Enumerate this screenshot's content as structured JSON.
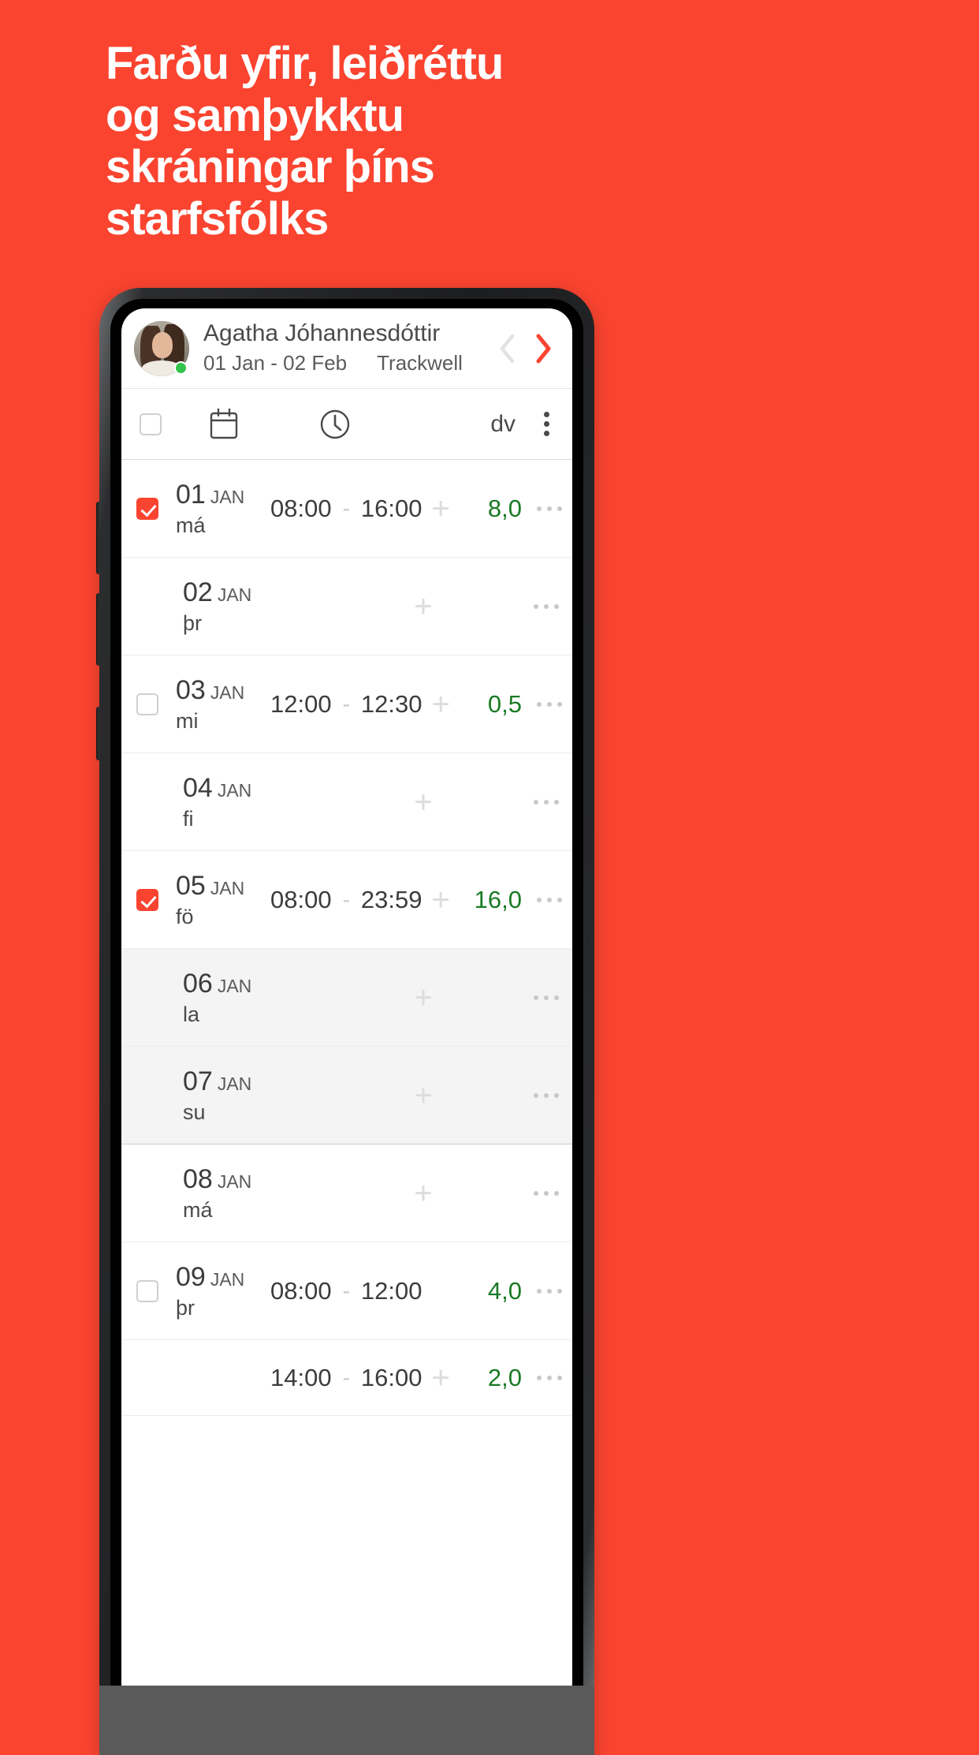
{
  "page": {
    "background_color": "#FA4430",
    "headline_lines": [
      "Farðu yfir, leiðréttu",
      "og samþykktu",
      "skráningar þíns",
      "starfsfólks"
    ]
  },
  "app": {
    "header": {
      "user_name": "Agatha Jóhannesdóttir",
      "date_range": "01 Jan - 02 Feb",
      "company": "Trackwell",
      "prev_label": "‹",
      "next_label": "›",
      "prev_color": "#e0e0e0",
      "next_color": "#FA4430",
      "avatar_name": "avatar",
      "status": "online"
    },
    "toolbar": {
      "select_all_checked": false,
      "calendar_icon": "calendar-icon",
      "clock_icon": "clock-icon",
      "value_column_label": "dv",
      "overflow_icon": "kebab-vertical-icon"
    },
    "accent_color": "#FA4430",
    "value_color": "#1a7a25",
    "rows": [
      {
        "checkbox": "checked",
        "day": "01",
        "month": "JAN",
        "weekday": "má",
        "start": "08:00",
        "end": "16:00",
        "has_plus": true,
        "value": "8,0",
        "weekend": false
      },
      {
        "checkbox": "none",
        "day": "02",
        "month": "JAN",
        "weekday": "þr",
        "start": "",
        "end": "",
        "has_plus": true,
        "value": "",
        "weekend": false
      },
      {
        "checkbox": "unchecked",
        "day": "03",
        "month": "JAN",
        "weekday": "mi",
        "start": "12:00",
        "end": "12:30",
        "has_plus": true,
        "value": "0,5",
        "weekend": false
      },
      {
        "checkbox": "none",
        "day": "04",
        "month": "JAN",
        "weekday": "fi",
        "start": "",
        "end": "",
        "has_plus": true,
        "value": "",
        "weekend": false
      },
      {
        "checkbox": "checked",
        "day": "05",
        "month": "JAN",
        "weekday": "fö",
        "start": "08:00",
        "end": "23:59",
        "has_plus": true,
        "value": "16,0",
        "weekend": false
      },
      {
        "checkbox": "none",
        "day": "06",
        "month": "JAN",
        "weekday": "la",
        "start": "",
        "end": "",
        "has_plus": true,
        "value": "",
        "weekend": true
      },
      {
        "checkbox": "none",
        "day": "07",
        "month": "JAN",
        "weekday": "su",
        "start": "",
        "end": "",
        "has_plus": true,
        "value": "",
        "weekend": true
      },
      {
        "checkbox": "none",
        "day": "08",
        "month": "JAN",
        "weekday": "má",
        "start": "",
        "end": "",
        "has_plus": true,
        "value": "",
        "weekend": false
      },
      {
        "checkbox": "unchecked",
        "day": "09",
        "month": "JAN",
        "weekday": "þr",
        "start": "08:00",
        "end": "12:00",
        "has_plus": false,
        "value": "4,0",
        "weekend": false
      },
      {
        "checkbox": "none",
        "day": "",
        "month": "",
        "weekday": "",
        "start": "14:00",
        "end": "16:00",
        "has_plus": true,
        "value": "2,0",
        "weekend": false
      }
    ],
    "row_separator": "-"
  }
}
